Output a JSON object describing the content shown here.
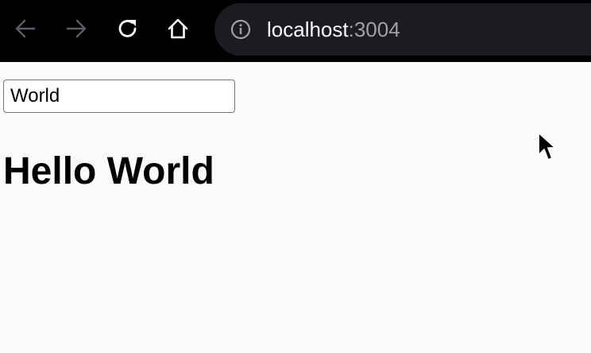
{
  "browser": {
    "url_host": "localhost",
    "url_port": ":3004",
    "icons": {
      "back": "arrow-left-icon",
      "forward": "arrow-right-icon",
      "reload": "reload-icon",
      "home": "home-icon",
      "info": "info-icon"
    },
    "colors": {
      "toolbar_bg": "#000000",
      "urlbar_bg": "#1c1b22",
      "icon_active": "#fbfbfe",
      "icon_disabled": "#5b5b66",
      "port_text": "#a0a0ab"
    }
  },
  "page": {
    "input_value": "World",
    "greeting": "Hello World",
    "background": "#fbfbfe"
  }
}
